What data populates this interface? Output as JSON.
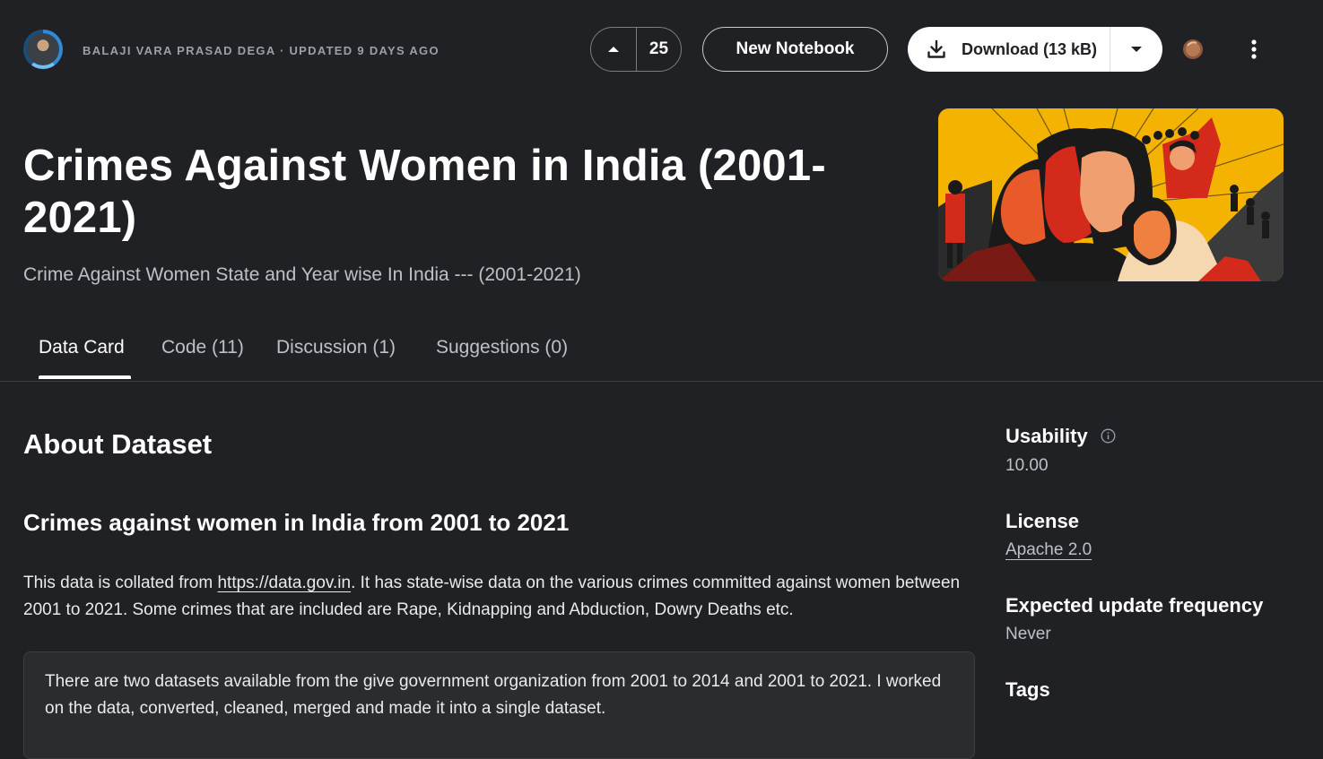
{
  "header": {
    "byline": "BALAJI VARA PRASAD DEGA · UPDATED 9 DAYS AGO",
    "vote_count": "25",
    "new_notebook_label": "New Notebook",
    "download_label": "Download (13 kB)"
  },
  "dataset": {
    "title": "Crimes Against Women in India (2001-2021)",
    "subtitle": "Crime Against Women State and Year wise In India --- (2001-2021)"
  },
  "tabs": [
    {
      "label": "Data Card"
    },
    {
      "label": "Code (11)"
    },
    {
      "label": "Discussion (1)"
    },
    {
      "label": "Suggestions (0)"
    }
  ],
  "about": {
    "heading": "About Dataset",
    "subheading": "Crimes against women in India from 2001 to 2021",
    "para_prefix": "This data is collated from ",
    "link_text": "https://data.gov.in",
    "para_suffix": ". It has state-wise data on the various crimes committed against women between 2001 to 2021. Some crimes that are included are Rape, Kidnapping and Abduction, Dowry Deaths etc.",
    "note": "There are two datasets available from the give government organization from 2001 to 2014 and 2001 to 2021. I worked on the data, converted, cleaned, merged and made it into a single dataset."
  },
  "sidebar": {
    "usability_label": "Usability",
    "usability_value": "10.00",
    "license_label": "License",
    "license_value": "Apache 2.0",
    "frequency_label": "Expected update frequency",
    "frequency_value": "Never",
    "tags_label": "Tags"
  },
  "icons": {
    "upvote": "caret-up-icon",
    "download": "download-icon",
    "dropdown": "chevron-down-icon",
    "medal": "bronze-medal-icon",
    "more": "more-vert-icon",
    "info": "info-icon"
  },
  "colors": {
    "background": "#202124",
    "text": "#e8eaed",
    "muted": "#bdc1c6"
  }
}
